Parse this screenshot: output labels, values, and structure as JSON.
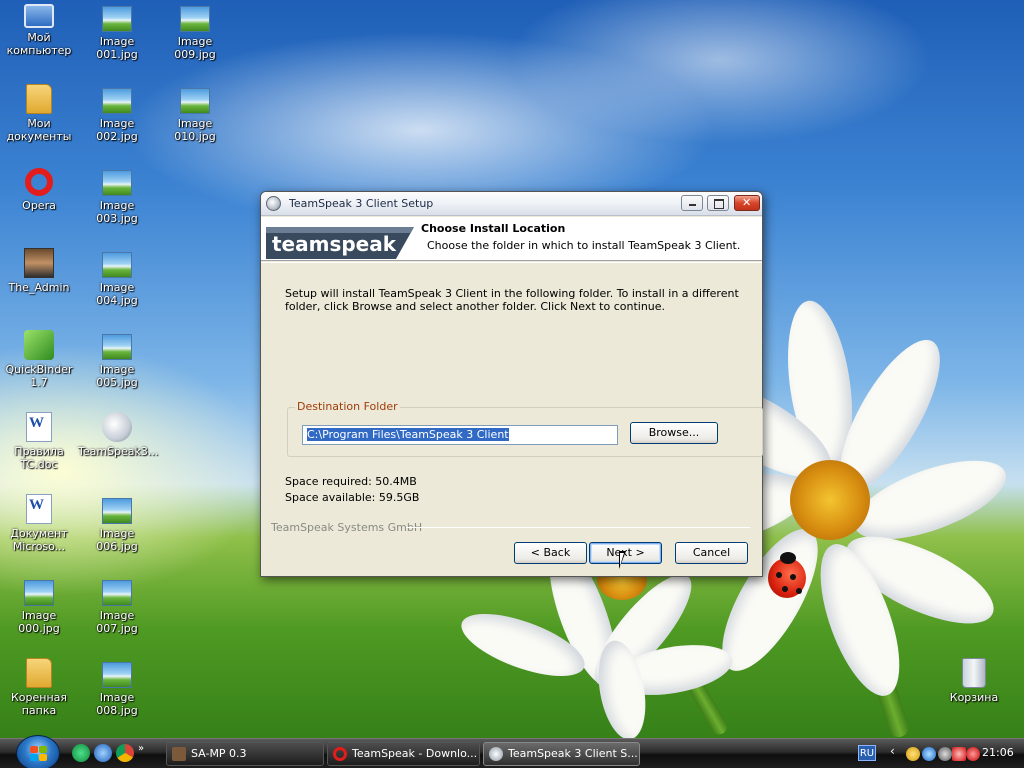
{
  "desktop": {
    "icons": [
      {
        "label": "Мой компьютер",
        "icon": "computer-icon"
      },
      {
        "label": "Мои документы",
        "icon": "folder-icon"
      },
      {
        "label": "Opera",
        "icon": "opera-icon"
      },
      {
        "label": "The_Admin",
        "icon": "avatar-icon"
      },
      {
        "label": "QuickBinder 1.7",
        "icon": "quickbinder-icon"
      },
      {
        "label": "Правила TC.doc",
        "icon": "word-doc-icon"
      },
      {
        "label": "Документ Microso...",
        "icon": "word-doc-icon"
      },
      {
        "label": "Image 000.jpg",
        "icon": "image-icon"
      },
      {
        "label": "Коренная папка",
        "icon": "folder-icon"
      },
      {
        "label": "Image 001.jpg",
        "icon": "image-icon"
      },
      {
        "label": "Image 002.jpg",
        "icon": "image-icon"
      },
      {
        "label": "Image 003.jpg",
        "icon": "image-icon"
      },
      {
        "label": "Image 004.jpg",
        "icon": "image-icon"
      },
      {
        "label": "Image 005.jpg",
        "icon": "image-icon"
      },
      {
        "label": "TeamSpeak3...",
        "icon": "teamspeak-icon"
      },
      {
        "label": "Image 006.jpg",
        "icon": "image-icon"
      },
      {
        "label": "Image 007.jpg",
        "icon": "image-icon"
      },
      {
        "label": "Image 008.jpg",
        "icon": "image-icon"
      },
      {
        "label": "Image 009.jpg",
        "icon": "image-icon"
      },
      {
        "label": "Image 010.jpg",
        "icon": "image-icon"
      },
      {
        "label": "Корзина",
        "icon": "recycle-bin-icon"
      }
    ]
  },
  "dialog": {
    "title": "TeamSpeak 3 Client Setup",
    "logo_text": "teamspeak",
    "header_title": "Choose Install Location",
    "header_subtitle": "Choose the folder in which to install TeamSpeak 3 Client.",
    "intro_text": "Setup will install TeamSpeak 3 Client in the following folder. To install in a different folder, click Browse and select another folder. Click Next to continue.",
    "group_label": "Destination Folder",
    "path_value": "C:\\Program Files\\TeamSpeak 3 Client",
    "browse_label": "Browse...",
    "space_required": "Space required: 50.4MB",
    "space_available": "Space available: 59.5GB",
    "brand_text": "TeamSpeak Systems GmbH",
    "back_label": "< Back",
    "next_label": "Next >",
    "cancel_label": "Cancel"
  },
  "taskbar": {
    "tasks": [
      {
        "label": "SA-MP 0.3",
        "icon": "samp-icon"
      },
      {
        "label": "TeamSpeak - Downlo...",
        "icon": "opera-icon"
      },
      {
        "label": "TeamSpeak 3 Client S...",
        "icon": "teamspeak-icon",
        "active": true
      }
    ],
    "language": "RU",
    "clock": "21:06",
    "quick_launch_more": "»"
  },
  "colors": {
    "dialog_bg": "#ece9d8",
    "group_label": "#a03c0a",
    "selection": "#316ac5"
  }
}
